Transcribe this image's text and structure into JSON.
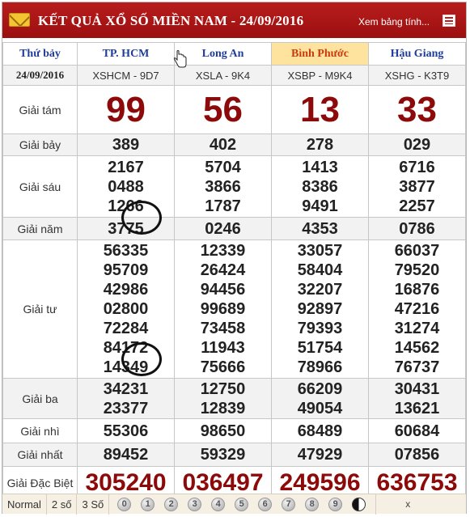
{
  "header": {
    "title": "KẾT QUẢ XỔ SỐ MIỀN NAM - 24/09/2016",
    "view_all": "Xem bảng tính...",
    "mail_icon": "mail-icon",
    "table_icon": "table-icon",
    "background": "#a51414"
  },
  "table": {
    "day_label": "Thứ bảy",
    "date": "24/09/2016",
    "provinces": [
      {
        "name": "TP. HCM",
        "code": "XSHCM - 9D7",
        "highlight": false
      },
      {
        "name": "Long An",
        "code": "XSLA - 9K4",
        "highlight": false
      },
      {
        "name": "Bình Phước",
        "code": "XSBP - M9K4",
        "highlight": true
      },
      {
        "name": "Hậu Giang",
        "code": "XSHG - K3T9",
        "highlight": false
      }
    ],
    "prizes": {
      "g8": {
        "label": "Giải tám",
        "values": [
          "99",
          "56",
          "13",
          "33"
        ]
      },
      "g7": {
        "label": "Giải bảy",
        "values": [
          "389",
          "402",
          "278",
          "029"
        ]
      },
      "g6": {
        "label": "Giải sáu",
        "values": [
          [
            "2167",
            "0488",
            "1266"
          ],
          [
            "5704",
            "3866",
            "1787"
          ],
          [
            "1413",
            "8386",
            "9491"
          ],
          [
            "6716",
            "3877",
            "2257"
          ]
        ]
      },
      "g5": {
        "label": "Giải năm",
        "values": [
          "3775",
          "0246",
          "4353",
          "0786"
        ]
      },
      "g4": {
        "label": "Giải tư",
        "values": [
          [
            "56335",
            "95709",
            "42986",
            "02800",
            "72284",
            "84172",
            "14349"
          ],
          [
            "12339",
            "26424",
            "94456",
            "99689",
            "73458",
            "11943",
            "75666"
          ],
          [
            "33057",
            "58404",
            "32207",
            "92897",
            "79393",
            "51754",
            "78966"
          ],
          [
            "66037",
            "79520",
            "16876",
            "47216",
            "31274",
            "14562",
            "76737"
          ]
        ]
      },
      "g3": {
        "label": "Giải ba",
        "values": [
          [
            "34231",
            "23377"
          ],
          [
            "12750",
            "12839"
          ],
          [
            "66209",
            "49054"
          ],
          [
            "30431",
            "13621"
          ]
        ]
      },
      "g2": {
        "label": "Giải nhì",
        "values": [
          "55306",
          "98650",
          "68489",
          "60684"
        ]
      },
      "g1": {
        "label": "Giải nhất",
        "values": [
          "89452",
          "59329",
          "47929",
          "07856"
        ]
      },
      "db": {
        "label": "Giải Đặc Biệt",
        "values": [
          "305240",
          "036497",
          "249596",
          "636753"
        ]
      }
    },
    "accent_color": "#8c0a0a"
  },
  "annotations": {
    "icon": "circle-annotation",
    "count": 2
  },
  "toolbar": {
    "normal": "Normal",
    "two_digits": "2 số",
    "three_digits": "3 Số",
    "digits": [
      "0",
      "1",
      "2",
      "3",
      "4",
      "5",
      "6",
      "7",
      "8",
      "9"
    ],
    "yin_yang_icon": "yin-yang-icon",
    "close": "x"
  }
}
